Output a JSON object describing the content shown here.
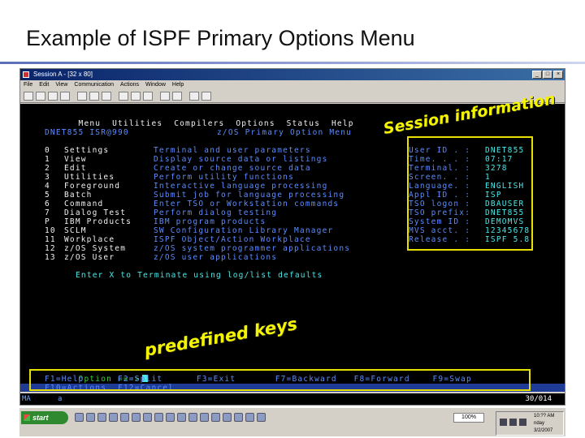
{
  "slide": {
    "title": "Example of ISPF Primary Options Menu"
  },
  "window": {
    "title": "Session A - [32 x 80]",
    "controls": [
      "_",
      "□",
      "×"
    ],
    "menu": [
      "File",
      "Edit",
      "View",
      "Communication",
      "Actions",
      "Window",
      "Help"
    ]
  },
  "ispf": {
    "action_bar": [
      "Menu",
      "Utilities",
      "Compilers",
      "Options",
      "Status",
      "Help"
    ],
    "user_line": "DNET855 ISR@990",
    "panel_title": "z/OS Primary Option Menu",
    "options": [
      {
        "code": "0",
        "name": "Settings",
        "desc": "Terminal and user parameters"
      },
      {
        "code": "1",
        "name": "View",
        "desc": "Display source data or listings"
      },
      {
        "code": "2",
        "name": "Edit",
        "desc": "Create or change source data"
      },
      {
        "code": "3",
        "name": "Utilities",
        "desc": "Perform utility functions"
      },
      {
        "code": "4",
        "name": "Foreground",
        "desc": "Interactive language processing"
      },
      {
        "code": "5",
        "name": "Batch",
        "desc": "Submit job for language processing"
      },
      {
        "code": "6",
        "name": "Command",
        "desc": "Enter TSO or Workstation commands"
      },
      {
        "code": "7",
        "name": "Dialog Test",
        "desc": "Perform dialog testing"
      },
      {
        "code": "P",
        "name": "IBM Products",
        "desc": "IBM program products"
      },
      {
        "code": "10",
        "name": "SCLM",
        "desc": "SW Configuration Library Manager"
      },
      {
        "code": "11",
        "name": "Workplace",
        "desc": "ISPF Object/Action Workplace"
      },
      {
        "code": "12",
        "name": "z/OS System",
        "desc": "z/OS system programmer applications"
      },
      {
        "code": "13",
        "name": "z/OS User",
        "desc": "z/OS user applications"
      }
    ],
    "session_info": [
      {
        "label": "User ID . :",
        "value": "DNET855"
      },
      {
        "label": "Time. . . :",
        "value": "07:17"
      },
      {
        "label": "Terminal. :",
        "value": "3278"
      },
      {
        "label": "Screen. . :",
        "value": "1"
      },
      {
        "label": "Language. :",
        "value": "ENGLISH"
      },
      {
        "label": "Appl ID . :",
        "value": "ISP"
      },
      {
        "label": "TSO logon :",
        "value": "DBAUSER"
      },
      {
        "label": "TSO prefix:",
        "value": "DNET855"
      },
      {
        "label": "System ID :",
        "value": "DEMOMVS"
      },
      {
        "label": "MVS acct. :",
        "value": "12345678"
      },
      {
        "label": "Release . :",
        "value": "ISPF 5.8"
      }
    ],
    "exit_line": "Enter X to Terminate using log/list defaults",
    "option_prompt": "Option ===>",
    "pf_keys_row1": "F1=Help      F2=Split      F3=Exit       F7=Backward   F8=Forward    F9=Swap",
    "pf_keys_row2": "F10=Actions  F12=Cancel",
    "oia": {
      "mode": "MA",
      "session": "a",
      "cursor_pos": "30/014"
    }
  },
  "annotations": {
    "session_label": "Session information",
    "keys_label": "predefined keys",
    "highlight_color": "#e8e000"
  },
  "taskbar": {
    "start_label": "start",
    "zoom": "100%",
    "clock_time": "10:?? AM",
    "clock_day": "nday",
    "clock_date": "3/2/2007"
  }
}
